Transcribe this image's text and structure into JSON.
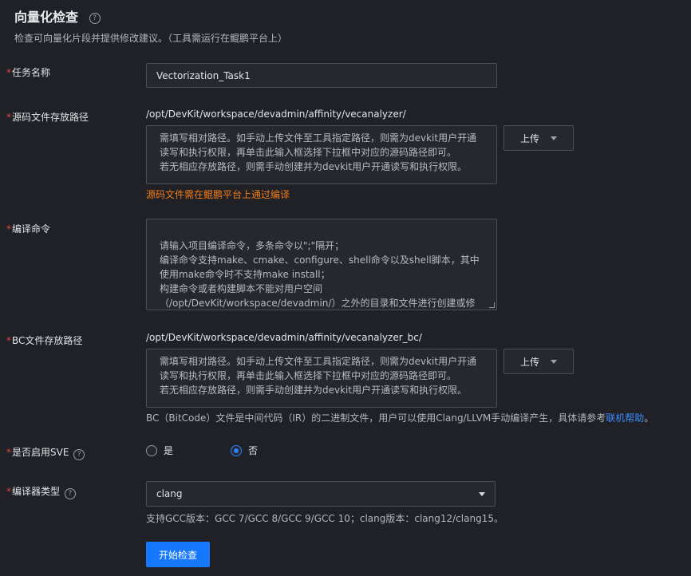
{
  "header": {
    "title": "向量化检查",
    "subtitle": "检查可向量化片段并提供修改建议。（工具需运行在鲲鹏平台上）"
  },
  "form": {
    "task_name": {
      "label": "任务名称",
      "value": "Vectorization_Task1"
    },
    "source_path": {
      "label": "源码文件存放路径",
      "prefix": "/opt/DevKit/workspace/devadmin/affinity/vecanalyzer/",
      "placeholder": "需填写相对路径。如手动上传文件至工具指定路径，则需为devkit用户开通读写和执行权限，再单击此输入框选择下拉框中对应的源码路径即可。\n若无相应存放路径，则需手动创建并为devkit用户开通读写和执行权限。",
      "upload_label": "上传",
      "warning": "源码文件需在鲲鹏平台上通过编译"
    },
    "compile_cmd": {
      "label": "编译命令",
      "placeholder": "请输入项目编译命令，多条命令以\";\"隔开；\n编译命令支持make、cmake、configure、shell命令以及shell脚本，其中使用make命令时不支持make install；\n构建命令或者构建脚本不能对用户空间（/opt/DevKit/workspace/devadmin/）之外的目录和文件进行创建或修改操作。"
    },
    "bc_path": {
      "label": "BC文件存放路径",
      "prefix": "/opt/DevKit/workspace/devadmin/affinity/vecanalyzer_bc/",
      "placeholder": "需填写相对路径。如手动上传文件至工具指定路径，则需为devkit用户开通读写和执行权限，再单击此输入框选择下拉框中对应的源码路径即可。\n若无相应存放路径，则需手动创建并为devkit用户开通读写和执行权限。",
      "upload_label": "上传",
      "hint": "BC（BitCode）文件是中间代码（IR）的二进制文件，用户可以使用Clang/LLVM手动编译产生，具体请参考",
      "hint_link": "联机帮助",
      "hint_end": "。"
    },
    "sve": {
      "label": "是否启用SVE",
      "options": [
        "是",
        "否"
      ],
      "selected": "否"
    },
    "compiler": {
      "label": "编译器类型",
      "value": "clang",
      "hint": "支持GCC版本：GCC 7/GCC 8/GCC 9/GCC 10；clang版本：clang12/clang15。"
    },
    "submit_label": "开始检查"
  },
  "colors": {
    "accent": "#1677ff",
    "warning": "#f07b1b",
    "required": "#e54545",
    "link": "#3d8cff"
  }
}
